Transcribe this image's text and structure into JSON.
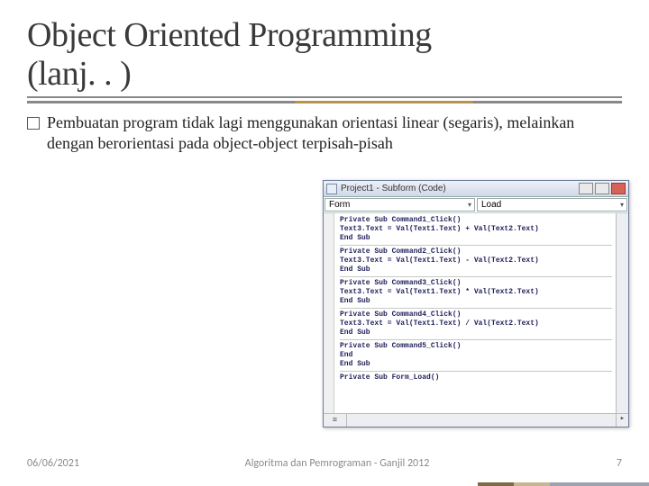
{
  "title_line1": "Object Oriented Programming",
  "title_line2": "(lanj. . )",
  "bullet": "Pembuatan program tidak lagi menggunakan orientasi linear (segaris), melainkan dengan berorientasi pada object-object terpisah-pisah",
  "code_window": {
    "title": "Project1 - Subform (Code)",
    "dropdown_left": "Form",
    "dropdown_right": "Load",
    "blocks": [
      [
        "Private Sub Command1_Click()",
        "Text3.Text = Val(Text1.Text) + Val(Text2.Text)",
        "End Sub"
      ],
      [
        "Private Sub Command2_Click()",
        "Text3.Text = Val(Text1.Text) - Val(Text2.Text)",
        "End Sub"
      ],
      [
        "Private Sub Command3_Click()",
        "Text3.Text = Val(Text1.Text) * Val(Text2.Text)",
        "End Sub"
      ],
      [
        "Private Sub Command4_Click()",
        "Text3.Text = Val(Text1.Text) / Val(Text2.Text)",
        "End Sub"
      ],
      [
        "Private Sub Command5_Click()",
        "End",
        "End Sub"
      ],
      [
        "Private Sub Form_Load()"
      ]
    ]
  },
  "footer": {
    "date": "06/06/2021",
    "center": "Algoritma dan Pemrograman - Ganjil 2012",
    "page": "7"
  }
}
